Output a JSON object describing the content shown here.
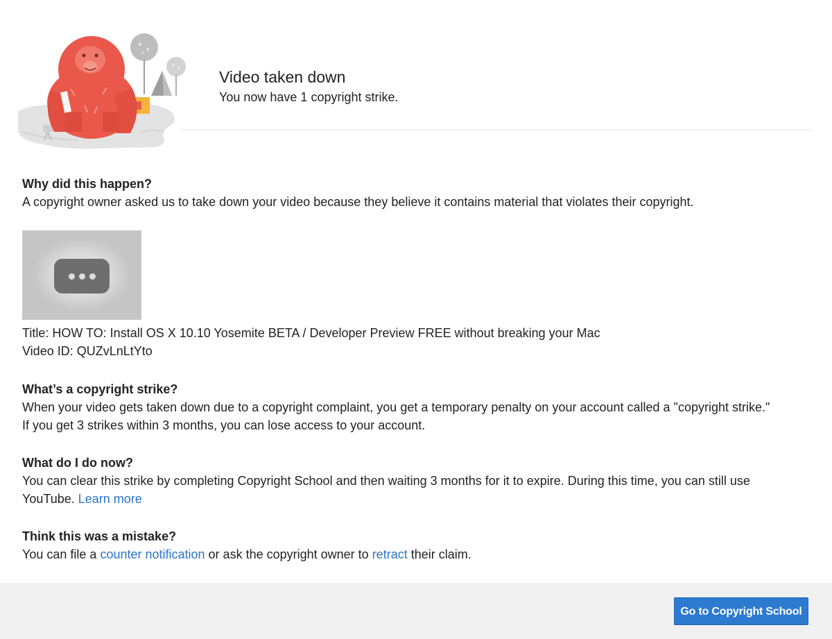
{
  "header": {
    "title": "Video taken down",
    "subtitle": "You now have 1 copyright strike."
  },
  "why": {
    "heading": "Why did this happen?",
    "body": "A copyright owner asked us to take down your video because they believe it contains material that violates their copyright."
  },
  "video": {
    "title_line": "Title: HOW TO: Install OS X 10.10 Yosemite BETA / Developer Preview FREE without breaking your Mac",
    "id_line": "Video ID: QUZvLnLtYto"
  },
  "strike": {
    "heading": "What’s a copyright strike?",
    "line1": "When your video gets taken down due to a copyright complaint, you get a temporary penalty on your account called a \"copyright strike.\"",
    "line2": "If you get 3 strikes within 3 months, you can lose access to your account."
  },
  "what_now": {
    "heading": "What do I do now?",
    "line1": "You can clear this strike by completing Copyright School and then waiting 3 months for it to expire. During this time, you can still use",
    "line2_prefix": "YouTube.",
    "learn_more": "Learn more"
  },
  "mistake": {
    "heading": "Think this was a mistake?",
    "prefix": "You can file a",
    "counter_link": "counter notification",
    "middle": "or ask the copyright owner to",
    "retract_link": "retract",
    "suffix": "their claim."
  },
  "footer": {
    "button_label": "Go to Copyright School"
  },
  "colors": {
    "link": "#2a74c5",
    "button": "#2d7ad1",
    "footer_bg": "#f1f1f1",
    "mascot": "#e9584a"
  },
  "icons": {
    "illustration": "red-yeti-mascot-illustration",
    "thumbnail": "video-unavailable-dots-icon"
  }
}
